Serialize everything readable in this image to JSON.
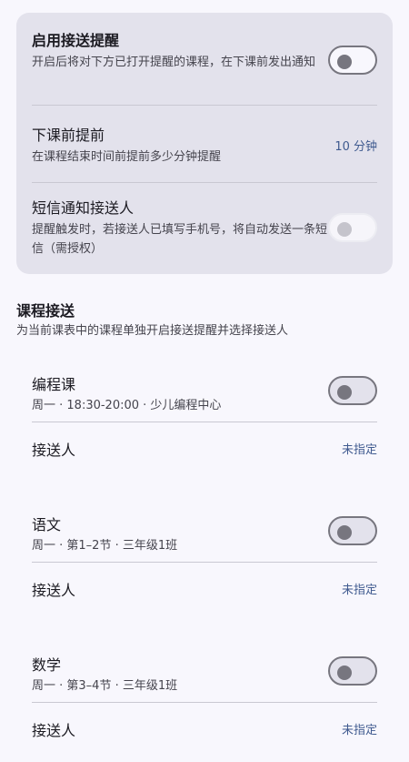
{
  "settings": {
    "enable_reminder": {
      "title": "启用接送提醒",
      "desc": "开启后将对下方已打开提醒的课程，在下课前发出通知",
      "toggle_on": false
    },
    "advance": {
      "title": "下课前提前",
      "desc": "在课程结束时间前提前多少分钟提醒",
      "value": "10 分钟"
    },
    "sms": {
      "title": "短信通知接送人",
      "desc": "提醒触发时，若接送人已填写手机号，将自动发送一条短信（需授权）",
      "toggle_on": false,
      "toggle_enabled": false
    }
  },
  "section": {
    "title": "课程接送",
    "desc": "为当前课表中的课程单独开启接送提醒并选择接送人"
  },
  "courses": [
    {
      "name": "编程课",
      "meta": "周一 · 18:30-20:00 · 少儿编程中心",
      "pickup_label": "接送人",
      "pickup_value": "未指定",
      "toggle_on": false
    },
    {
      "name": "语文",
      "meta": "周一 · 第1–2节 · 三年级1班",
      "pickup_label": "接送人",
      "pickup_value": "未指定",
      "toggle_on": false
    },
    {
      "name": "数学",
      "meta": "周一 · 第3–4节 · 三年级1班",
      "pickup_label": "接送人",
      "pickup_value": "未指定",
      "toggle_on": false
    }
  ],
  "colors": {
    "background": "#f8f7fd",
    "card": "#e3e2ec",
    "accent_text": "#3f5a8f",
    "toggle_outline": "#77767f"
  }
}
